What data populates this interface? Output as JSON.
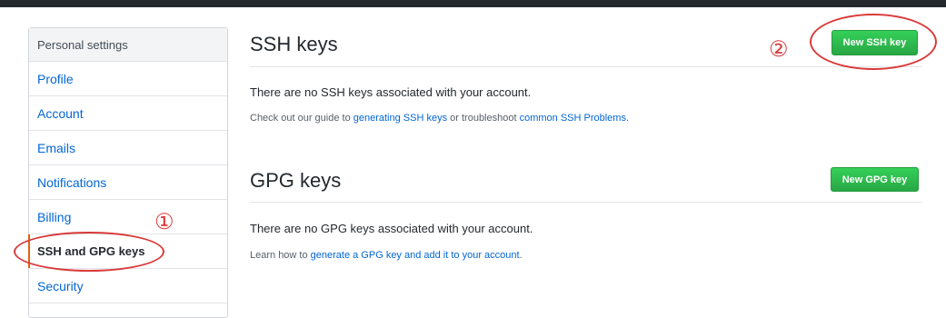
{
  "sidebar": {
    "header": "Personal settings",
    "items": [
      {
        "label": "Profile"
      },
      {
        "label": "Account"
      },
      {
        "label": "Emails"
      },
      {
        "label": "Notifications"
      },
      {
        "label": "Billing"
      },
      {
        "label": "SSH and GPG keys"
      },
      {
        "label": "Security"
      }
    ]
  },
  "ssh": {
    "title": "SSH keys",
    "new_button": "New SSH key",
    "empty_message": "There are no SSH keys associated with your account.",
    "help_prefix": "Check out our guide to ",
    "help_link1": "generating SSH keys",
    "help_middle": " or troubleshoot ",
    "help_link2": "common SSH Problems",
    "help_suffix": "."
  },
  "gpg": {
    "title": "GPG keys",
    "new_button": "New GPG key",
    "empty_message": "There are no GPG keys associated with your account.",
    "help_prefix": "Learn how to ",
    "help_link": "generate a GPG key and add it to your account",
    "help_suffix": "."
  },
  "annotations": {
    "step1": "①",
    "step2": "②"
  },
  "colors": {
    "accent_link": "#0366d6",
    "button_green": "#28a745",
    "annotation_red": "#d93a3a",
    "topbar": "#24292e"
  }
}
